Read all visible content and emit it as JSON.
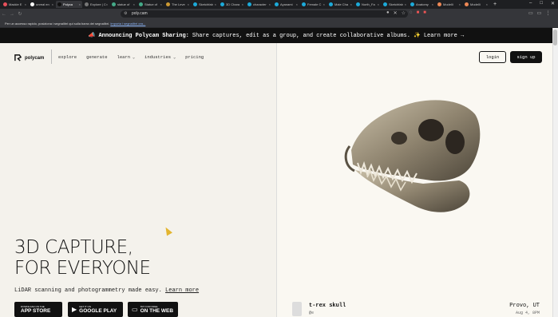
{
  "browser": {
    "tabs": [
      {
        "label": "Mackie E",
        "favicon_color": "#e8505b"
      },
      {
        "label": "unreal en",
        "favicon_color": "#ffffff"
      },
      {
        "label": "Polyca",
        "favicon_color": "#111111",
        "active": true
      },
      {
        "label": "Explore | C",
        "favicon_color": "#777777"
      },
      {
        "label": "statue of",
        "favicon_color": "#4a8"
      },
      {
        "label": "Statue of",
        "favicon_color": "#4a8"
      },
      {
        "label": "The Leve",
        "favicon_color": "#c93"
      },
      {
        "label": "Sketchfab",
        "favicon_color": "#1caad9"
      },
      {
        "label": "3D Chara",
        "favicon_color": "#1caad9"
      },
      {
        "label": "character",
        "favicon_color": "#1caad9"
      },
      {
        "label": "Ayanami",
        "favicon_color": "#1caad9"
      },
      {
        "label": "Female C",
        "favicon_color": "#1caad9"
      },
      {
        "label": "Male Cha",
        "favicon_color": "#1caad9"
      },
      {
        "label": "North_Fa",
        "favicon_color": "#1caad9"
      },
      {
        "label": "Sketchfab",
        "favicon_color": "#1caad9"
      },
      {
        "label": "Anatomy",
        "favicon_color": "#1caad9"
      },
      {
        "label": "Modelli",
        "favicon_color": "#e85"
      },
      {
        "label": "Modelli",
        "favicon_color": "#e85"
      }
    ],
    "url": "poly.cam",
    "bookmark_hint": "Per un accesso rapido, posiziona i segnalibri qui sulla barra dei segnalibri.",
    "bookmark_link": "Importa i segnalibri ora..."
  },
  "announcement": {
    "icon": "📣",
    "bold": "Announcing Polycam Sharing:",
    "text": "Share captures, edit as a group, and create collaborative albums. ✨",
    "link": "Learn more →"
  },
  "header": {
    "logo_text": "polycam",
    "nav": [
      "explore",
      "generate",
      "learn",
      "industries",
      "pricing"
    ],
    "login": "login",
    "signup": "sign up"
  },
  "hero": {
    "title_line1": "3D CAPTURE,",
    "title_line2": "FOR EVERYONE",
    "subtitle": "LiDAR scanning and photogrammetry made easy.",
    "subtitle_link": "Learn more",
    "stores": [
      {
        "small": "DOWNLOAD ON THE",
        "large": "APP STORE",
        "icon": "apple-icon"
      },
      {
        "small": "GET IT ON",
        "large": "GOOGLE PLAY",
        "icon": "play-icon"
      },
      {
        "small": "TRY FOR FREE",
        "large": "ON THE WEB",
        "icon": "laptop-icon"
      }
    ]
  },
  "capture": {
    "name": "t-rex skull",
    "user": "@e",
    "location": "Provo, UT",
    "date": "Aug 4, 8PM"
  }
}
